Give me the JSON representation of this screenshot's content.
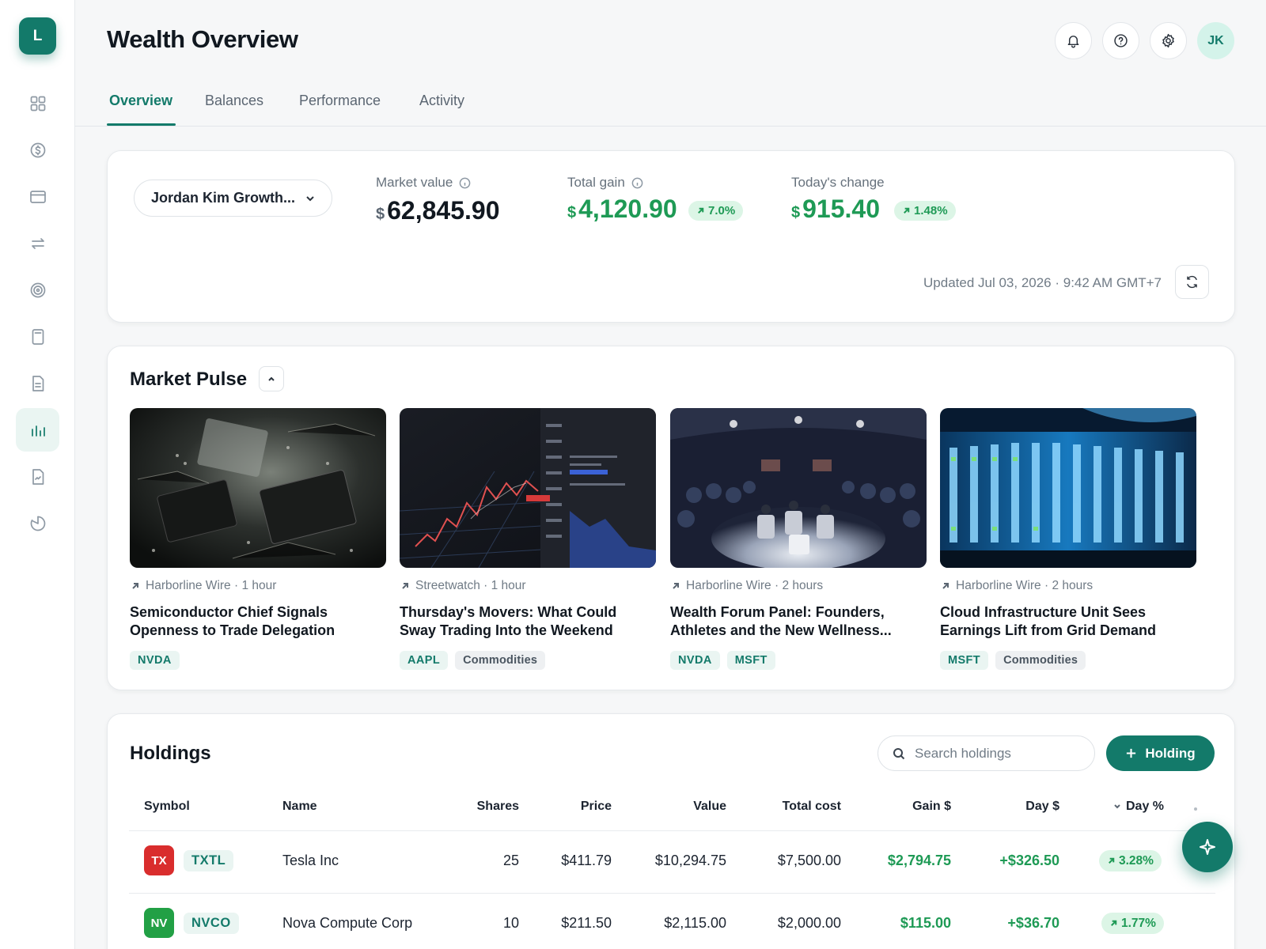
{
  "app": {
    "logo_letter": "L",
    "title": "Wealth Overview",
    "avatar_initials": "JK"
  },
  "colors": {
    "accent": "#137a6a",
    "gain": "#1e9a55",
    "gain_bg": "#dcf5e6"
  },
  "sidebar": {
    "items": [
      {
        "icon": "dashboard-icon"
      },
      {
        "icon": "currency-icon"
      },
      {
        "icon": "wallet-icon"
      },
      {
        "icon": "transfer-icon"
      },
      {
        "icon": "goals-icon"
      },
      {
        "icon": "calculator-icon"
      },
      {
        "icon": "document-icon"
      },
      {
        "icon": "investments-icon",
        "active": true
      },
      {
        "icon": "report-icon"
      },
      {
        "icon": "pie-chart-icon"
      }
    ]
  },
  "header": {
    "buttons": [
      "notifications-icon",
      "help-icon",
      "settings-icon"
    ]
  },
  "tabs": [
    {
      "label": "Overview",
      "active": true
    },
    {
      "label": "Balances"
    },
    {
      "label": "Performance"
    },
    {
      "label": "Activity"
    }
  ],
  "summary": {
    "account": "Jordan Kim Growth...",
    "market_value": {
      "label": "Market value",
      "currency": "$",
      "value": "62,845.90"
    },
    "total_gain": {
      "label": "Total gain",
      "currency": "$",
      "value": "4,120.90",
      "percent": "7.0%"
    },
    "todays_change": {
      "label": "Today's change",
      "currency": "$",
      "value": "915.40",
      "percent": "1.48%"
    },
    "updated": "Updated Jul 03, 2026 · 9:42 AM GMT+7"
  },
  "market_pulse": {
    "title": "Market Pulse",
    "articles": [
      {
        "source": "Harborline Wire · 1 hour",
        "title": "Semiconductor Chief Signals Openness to Trade Delegation",
        "tags": [
          {
            "label": "NVDA",
            "kind": "ticker"
          }
        ],
        "image": "circuit-board"
      },
      {
        "source": "Streetwatch · 1 hour",
        "title": "Thursday's Movers: What Could Sway Trading Into the Weekend",
        "tags": [
          {
            "label": "AAPL",
            "kind": "ticker"
          },
          {
            "label": "Commodities",
            "kind": "topic"
          }
        ],
        "image": "trading-chart"
      },
      {
        "source": "Harborline Wire · 2 hours",
        "title": "Wealth Forum Panel: Founders, Athletes and the New Wellness...",
        "tags": [
          {
            "label": "NVDA",
            "kind": "ticker"
          },
          {
            "label": "MSFT",
            "kind": "ticker"
          }
        ],
        "image": "forum-panel"
      },
      {
        "source": "Harborline Wire · 2 hours",
        "title": "Cloud Infrastructure Unit Sees Earnings Lift from Grid Demand",
        "tags": [
          {
            "label": "MSFT",
            "kind": "ticker"
          },
          {
            "label": "Commodities",
            "kind": "topic"
          }
        ],
        "image": "server-rack"
      }
    ]
  },
  "holdings": {
    "title": "Holdings",
    "search_placeholder": "Search holdings",
    "add_label": "Holding",
    "columns": [
      "Symbol",
      "Name",
      "Shares",
      "Price",
      "Value",
      "Total cost",
      "Gain $",
      "Day $",
      "Day %"
    ],
    "rows": [
      {
        "logo": "TX",
        "logo_color": "#d92d2d",
        "symbol": "TXTL",
        "name": "Tesla Inc",
        "shares": "25",
        "price": "$411.79",
        "value": "$10,294.75",
        "total_cost": "$7,500.00",
        "gain": "$2,794.75",
        "day_dollar": "+$326.50",
        "day_pct": "3.28%"
      },
      {
        "logo": "NV",
        "logo_color": "#22a045",
        "symbol": "NVCO",
        "name": "Nova Compute Corp",
        "shares": "10",
        "price": "$211.50",
        "value": "$2,115.00",
        "total_cost": "$2,000.00",
        "gain": "$115.00",
        "day_dollar": "+$36.70",
        "day_pct": "1.77%"
      }
    ]
  }
}
